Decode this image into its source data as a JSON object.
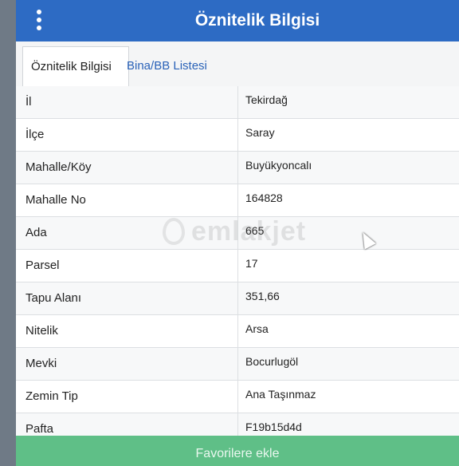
{
  "header": {
    "title": "Öznitelik Bilgisi",
    "menu_icon": "vertical-dots-icon"
  },
  "tabs": [
    {
      "label": "Öznitelik Bilgisi",
      "active": true
    },
    {
      "label": "Bina/BB Listesi",
      "active": false
    }
  ],
  "attributes": [
    {
      "label": "İl",
      "value": "Tekirdağ"
    },
    {
      "label": "İlçe",
      "value": "Saray"
    },
    {
      "label": "Mahalle/Köy",
      "value": "Buyükyoncalı"
    },
    {
      "label": "Mahalle No",
      "value": "164828"
    },
    {
      "label": "Ada",
      "value": "665"
    },
    {
      "label": "Parsel",
      "value": "17"
    },
    {
      "label": "Tapu Alanı",
      "value": "351,66"
    },
    {
      "label": "Nitelik",
      "value": "Arsa"
    },
    {
      "label": "Mevki",
      "value": "Bocurlugöl"
    },
    {
      "label": "Zemin Tip",
      "value": "Ana Taşınmaz"
    },
    {
      "label": "Pafta",
      "value": "F19b15d4d"
    }
  ],
  "footer": {
    "favorite_label": "Favorilere ekle"
  },
  "watermark": {
    "text": "emlakjet"
  },
  "colors": {
    "header": "#2d6bc4",
    "favorite_button": "#5fbf87",
    "tab_link": "#2a62b8"
  }
}
